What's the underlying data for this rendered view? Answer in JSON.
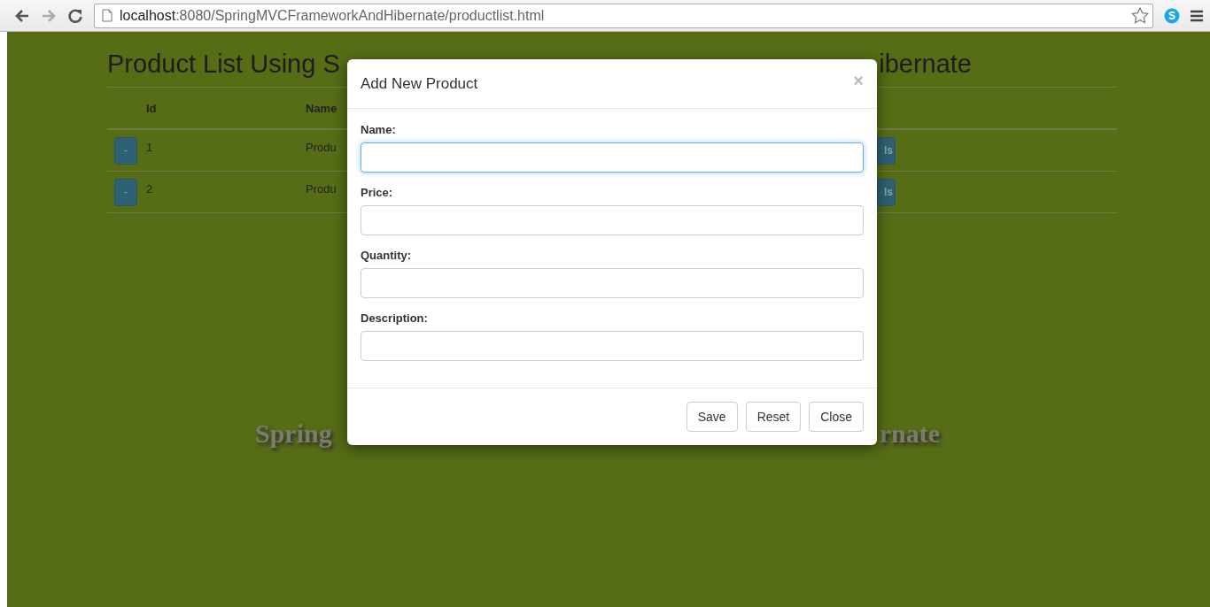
{
  "browser": {
    "back_enabled": true,
    "forward_enabled": false,
    "url_host": "localhost",
    "url_path": ":8080/SpringMVCFrameworkAndHibernate/productlist.html"
  },
  "page": {
    "title_left": "Product List Using S",
    "title_right": "ibernate",
    "table": {
      "columns": [
        "Id",
        "Name"
      ],
      "rows": [
        {
          "action": "-",
          "id": "1",
          "name": "Produ",
          "details": "ls"
        },
        {
          "action": "-",
          "id": "2",
          "name": "Produ",
          "details": "ls"
        }
      ]
    },
    "banner_left": "Spring",
    "banner_right": "rnate"
  },
  "modal": {
    "title": "Add New Product",
    "close": "×",
    "fields": [
      {
        "label": "Name:",
        "focused": true
      },
      {
        "label": "Price:",
        "focused": false
      },
      {
        "label": "Quantity:",
        "focused": false
      },
      {
        "label": "Description:",
        "focused": false
      }
    ],
    "buttons": [
      "Save",
      "Reset",
      "Close"
    ]
  }
}
